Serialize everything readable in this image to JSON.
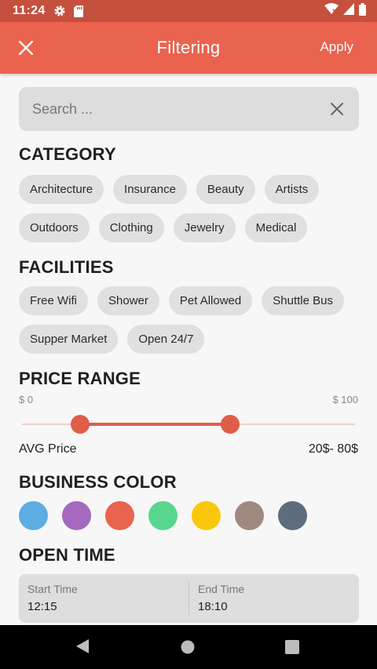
{
  "status_bar": {
    "time": "11:24",
    "icons": [
      "gear-icon",
      "sd-card-icon",
      "wifi-icon",
      "signal-icon",
      "battery-icon"
    ]
  },
  "app_bar": {
    "title": "Filtering",
    "apply_label": "Apply",
    "close_icon": "close-icon",
    "background": "#e9634e"
  },
  "search": {
    "placeholder": "Search ...",
    "value": ""
  },
  "category": {
    "title": "CATEGORY",
    "rows": [
      [
        "Architecture",
        "Insurance",
        "Beauty",
        "Artists"
      ],
      [
        "Outdoors",
        "Clothing",
        "Jewelry",
        "Medical"
      ]
    ]
  },
  "facilities": {
    "title": "FACILITIES",
    "rows": [
      [
        "Free Wifi",
        "Shower",
        "Pet Allowed",
        "Shuttle Bus"
      ],
      [
        "Supper Market",
        "Open 24/7"
      ]
    ]
  },
  "price_range": {
    "title": "PRICE RANGE",
    "min_label": "$ 0",
    "max_label": "$ 100",
    "min": 0,
    "max": 100,
    "low": 20,
    "high": 80,
    "avg_label": "AVG Price",
    "avg_value": "20$- 80$",
    "accent": "#e05d4a"
  },
  "business_color": {
    "title": "BUSINESS COLOR",
    "colors": [
      "#5dade2",
      "#a569bd",
      "#e9634e",
      "#58d68d",
      "#f9c80e",
      "#a1887f",
      "#5d6d7e"
    ]
  },
  "open_time": {
    "title": "OPEN TIME",
    "start_label": "Start Time",
    "start_value": "12:15",
    "end_label": "End Time",
    "end_value": "18:10"
  },
  "nav_bar": {
    "icons": [
      "back-icon",
      "home-icon",
      "recents-icon"
    ]
  }
}
